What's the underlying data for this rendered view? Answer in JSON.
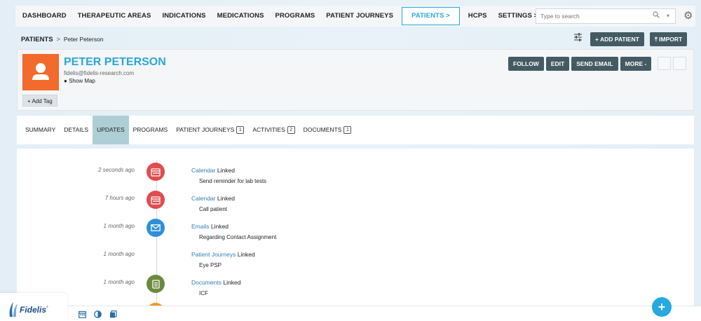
{
  "nav": {
    "items": [
      {
        "label": "DASHBOARD"
      },
      {
        "label": "THERAPEUTIC AREAS"
      },
      {
        "label": "INDICATIONS"
      },
      {
        "label": "MEDICATIONS"
      },
      {
        "label": "PROGRAMS"
      },
      {
        "label": "PATIENT JOURNEYS"
      },
      {
        "label": "PATIENTS >"
      },
      {
        "label": "HCPS"
      },
      {
        "label": "SETTINGS >"
      }
    ],
    "active_label": "PATIENTS >",
    "search_placeholder": "Type to search"
  },
  "breadcrumb": {
    "root": "PATIENTS",
    "separator": ">",
    "current": "Peter Peterson"
  },
  "toolbar": {
    "add_patient_label": "+ ADD PATIENT",
    "import_label": "IMPORT"
  },
  "profile": {
    "name": "PETER PETERSON",
    "email": "fidelis@fidelis-research.com",
    "show_map_label": "Show Map",
    "add_tag_label": "+ Add Tag",
    "actions": {
      "follow": "FOLLOW",
      "edit": "EDIT",
      "send_email": "SEND EMAIL",
      "more": "MORE -"
    },
    "avatar_color": "#f26a2c"
  },
  "tabs": [
    {
      "label": "SUMMARY",
      "badge": ""
    },
    {
      "label": "DETAILS",
      "badge": ""
    },
    {
      "label": "UPDATES",
      "badge": ""
    },
    {
      "label": "PROGRAMS",
      "badge": ""
    },
    {
      "label": "PATIENT JOURNEYS",
      "badge": "1"
    },
    {
      "label": "ACTIVITIES",
      "badge": "2"
    },
    {
      "label": "DOCUMENTS",
      "badge": "1"
    }
  ],
  "active_tab": "UPDATES",
  "updates": [
    {
      "when": "2 seconds ago",
      "icon": "calendar-icon",
      "module": "Calendar",
      "action": "Linked",
      "detail": "Send reminder for lab tests"
    },
    {
      "when": "7 hours ago",
      "icon": "calendar-icon",
      "module": "Calendar",
      "action": "Linked",
      "detail": "Call patient"
    },
    {
      "when": "1 month ago",
      "icon": "envelope-icon",
      "module": "Emails",
      "action": "Linked",
      "detail": "Regarding Contact Assignment"
    },
    {
      "when": "1 month ago",
      "icon": "",
      "module": "Patient Journeys",
      "action": "Linked",
      "detail": "Eye PSP"
    },
    {
      "when": "1 month ago",
      "icon": "document-icon",
      "module": "Documents",
      "action": "Linked",
      "detail": "ICF"
    }
  ],
  "logo": {
    "text": "Fidelis",
    "mark": "°"
  },
  "colors": {
    "accent": "#2aa7d6",
    "dark_button": "#445b63",
    "active_tab": "#aeced5",
    "calendar_icon": "#e04d4f",
    "email_icon": "#2e8fdc",
    "document_icon": "#6b8a3e",
    "fab": "#25a9e0"
  }
}
